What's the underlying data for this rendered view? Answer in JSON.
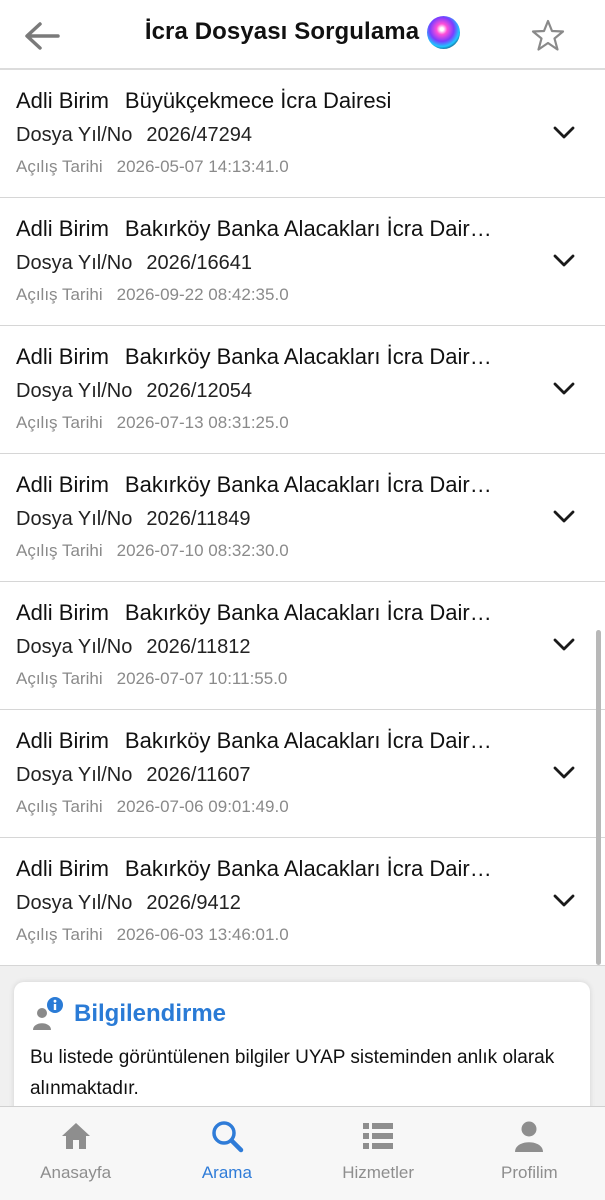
{
  "header": {
    "title": "İcra Dosyası Sorgulama"
  },
  "labels": {
    "unit": "Adli Birim",
    "file": "Dosya Yıl/No",
    "opened": "Açılış Tarihi"
  },
  "records": [
    {
      "unit": "Büyükçekmece İcra Dairesi",
      "file_no": "2026/47294",
      "opened": "2026-05-07 14:13:41.0"
    },
    {
      "unit": "Bakırköy Banka Alacakları İcra Dair…",
      "file_no": "2026/16641",
      "opened": "2026-09-22 08:42:35.0"
    },
    {
      "unit": "Bakırköy Banka Alacakları İcra Dair…",
      "file_no": "2026/12054",
      "opened": "2026-07-13 08:31:25.0"
    },
    {
      "unit": "Bakırköy Banka Alacakları İcra Dair…",
      "file_no": "2026/11849",
      "opened": "2026-07-10 08:32:30.0"
    },
    {
      "unit": "Bakırköy Banka Alacakları İcra Dair…",
      "file_no": "2026/11812",
      "opened": "2026-07-07 10:11:55.0"
    },
    {
      "unit": "Bakırköy Banka Alacakları İcra Dair…",
      "file_no": "2026/11607",
      "opened": "2026-07-06 09:01:49.0"
    },
    {
      "unit": "Bakırköy Banka Alacakları İcra Dair…",
      "file_no": "2026/9412",
      "opened": "2026-06-03 13:46:01.0"
    }
  ],
  "info": {
    "title": "Bilgilendirme",
    "text": "Bu listede görüntülenen bilgiler UYAP sisteminden anlık olarak alınmaktadır."
  },
  "tabs": [
    {
      "label": "Anasayfa",
      "icon": "home-icon",
      "active": false
    },
    {
      "label": "Arama",
      "icon": "search-icon",
      "active": true
    },
    {
      "label": "Hizmetler",
      "icon": "list-icon",
      "active": false
    },
    {
      "label": "Profilim",
      "icon": "person-icon",
      "active": false
    }
  ],
  "colors": {
    "accent": "#2f7cd8",
    "info_title": "#2a7bd6",
    "muted": "#8a8a8a"
  }
}
